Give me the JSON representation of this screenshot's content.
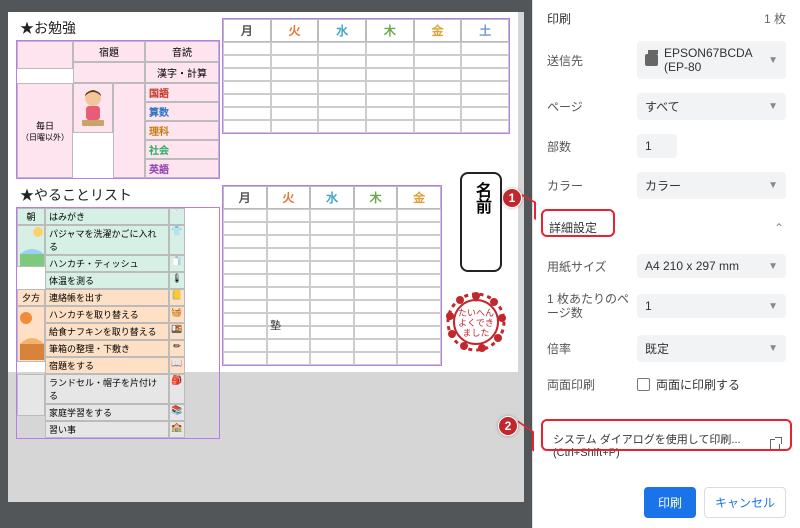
{
  "sidebar": {
    "title": "印刷",
    "sheet_count": "1 枚",
    "rows": {
      "destination": {
        "label": "送信先",
        "value": "EPSON67BCDA (EP-80"
      },
      "pages": {
        "label": "ページ",
        "value": "すべて"
      },
      "copies": {
        "label": "部数",
        "value": "1"
      },
      "color": {
        "label": "カラー",
        "value": "カラー"
      },
      "advanced": {
        "label": "詳細設定"
      },
      "paper": {
        "label": "用紙サイズ",
        "value": "A4 210 x 297 mm"
      },
      "per_sheet": {
        "label": "1 枚あたりのページ数",
        "value": "1"
      },
      "scale": {
        "label": "倍率",
        "value": "既定"
      },
      "duplex": {
        "label": "両面印刷",
        "checkbox_label": "両面に印刷する"
      }
    },
    "system_dialog": "システム ダイアログを使用して印刷... (Ctrl+Shift+P)",
    "buttons": {
      "print": "印刷",
      "cancel": "キャンセル"
    }
  },
  "callouts": {
    "one": "1",
    "two": "2"
  },
  "preview": {
    "section1": {
      "title": "★お勉強"
    },
    "days6": [
      "月",
      "火",
      "水",
      "木",
      "金",
      "土"
    ],
    "days5": [
      "月",
      "火",
      "水",
      "木",
      "金"
    ],
    "subject_header": {
      "every": "毎日",
      "every_sub": "（日曜以外）",
      "homework": "宿題",
      "ondoku": "音読",
      "kanji": "漢字・計算"
    },
    "subjects": [
      "国語",
      "算数",
      "理科",
      "社会",
      "英語"
    ],
    "section2": {
      "title": "★やることリスト"
    },
    "todo": {
      "asa_label": "朝",
      "asa": [
        "はみがき",
        "パジャマを洗濯かごに入れる",
        "ハンカチ・ティッシュ",
        "体温を測る"
      ],
      "yuu_label": "夕方",
      "yuu": [
        "連絡帳を出す",
        "ハンカチを取り替える",
        "給食ナフキンを取り替える",
        "筆箱の整理・下敷き",
        "宿題をする"
      ],
      "other": [
        "ランドセル・帽子を片付ける",
        "家庭学習をする",
        "習い事"
      ]
    },
    "juku": "塾",
    "name_box": "名前",
    "stamp": {
      "l1": "たいへん",
      "l2": "よくでき",
      "l3": "ました"
    }
  }
}
